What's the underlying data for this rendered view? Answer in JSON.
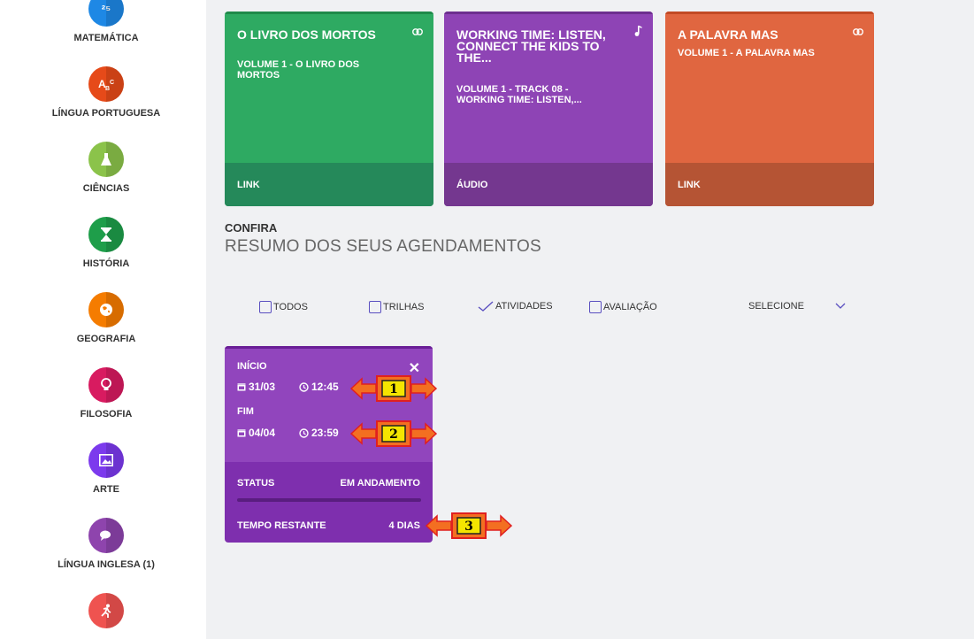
{
  "sidebar": {
    "subjects": [
      {
        "label": "MATEMÁTICA",
        "icon": "numbers-icon",
        "glyph": "²⁵",
        "color": "#1e88e5"
      },
      {
        "label": "LÍNGUA PORTUGUESA",
        "icon": "letters-icon",
        "glyph": "A",
        "color": "#e64a19"
      },
      {
        "label": "CIÊNCIAS",
        "icon": "flask-icon",
        "glyph": "",
        "color": "#8bc34a"
      },
      {
        "label": "HISTÓRIA",
        "icon": "hourglass-icon",
        "glyph": "",
        "color": "#1e9e4a"
      },
      {
        "label": "GEOGRAFIA",
        "icon": "globe-icon",
        "glyph": "",
        "color": "#f57c00"
      },
      {
        "label": "FILOSOFIA",
        "icon": "lightbulb-icon",
        "glyph": "",
        "color": "#d81b60"
      },
      {
        "label": "ARTE",
        "icon": "image-icon",
        "glyph": "",
        "color": "#7c3aed"
      },
      {
        "label": "LÍNGUA INGLESA (1)",
        "icon": "chat-bubbles-icon",
        "glyph": "",
        "color": "#8e44ad"
      },
      {
        "label": "",
        "icon": "running-person-icon",
        "glyph": "",
        "color": "#ef5350"
      }
    ]
  },
  "cards": [
    {
      "title": "O LIVRO DOS MORTOS",
      "subtitle": "VOLUME 1 - O LIVRO DOS MORTOS",
      "type": "LINK",
      "icon": "link-icon",
      "color": "#2eaa62",
      "footer_color": "#25895a"
    },
    {
      "title": "WORKING TIME: LISTEN, CONNECT THE KIDS TO THE...",
      "subtitle": "VOLUME 1 - TRACK 08 - WORKING TIME: LISTEN,...",
      "type": "ÁUDIO",
      "icon": "music-note-icon",
      "color": "#8e44b5",
      "footer_color": "#74378f"
    },
    {
      "title": "A PALAVRA MAS",
      "subtitle": "VOLUME 1 - A PALAVRA MAS",
      "type": "LINK",
      "icon": "link-icon",
      "color": "#e06640",
      "footer_color": "#b55434"
    }
  ],
  "section": {
    "kicker": "CONFIRA",
    "title": "RESUMO DOS SEUS AGENDAMENTOS"
  },
  "filters": {
    "todos": "TODOS",
    "trilhas": "TRILHAS",
    "atividades": "ATIVIDADES",
    "avaliacao": "AVALIAÇÃO",
    "select": "SELECIONE"
  },
  "schedule": {
    "start_label": "INÍCIO",
    "start_date": "31/03",
    "start_time": "12:45",
    "end_label": "FIM",
    "end_date": "04/04",
    "end_time": "23:59",
    "status_label": "STATUS",
    "status_value": "EM ANDAMENTO",
    "remaining_label": "TEMPO RESTANTE",
    "remaining_value": "4 DIAS"
  },
  "callouts": [
    "1",
    "2",
    "3"
  ]
}
